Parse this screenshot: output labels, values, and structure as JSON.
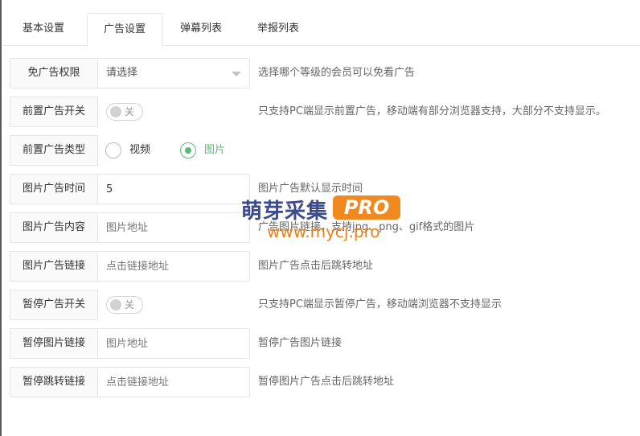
{
  "tabs": [
    {
      "label": "基本设置"
    },
    {
      "label": "广告设置"
    },
    {
      "label": "弹幕列表"
    },
    {
      "label": "举报列表"
    }
  ],
  "active_tab": "广告设置",
  "form": {
    "ad_free": {
      "label": "免广告权限",
      "selected": "请选择",
      "hint": "选择哪个等级的会员可以免看广告"
    },
    "pre_switch": {
      "label": "前置广告开关",
      "state": "关",
      "hint": "只支持PC端显示前置广告，移动端有部分浏览器支持，大部分不支持显示。"
    },
    "pre_type": {
      "label": "前置广告类型",
      "options": [
        "视频",
        "图片"
      ],
      "selected": "图片"
    },
    "img_time": {
      "label": "图片广告时间",
      "value": "5",
      "hint": "图片广告默认显示时间"
    },
    "img_content": {
      "label": "图片广告内容",
      "placeholder": "图片地址",
      "hint": "广告图片链接，支持jpg、png、gif格式的图片"
    },
    "img_link": {
      "label": "图片广告链接",
      "placeholder": "点击链接地址",
      "hint": "图片广告点击后跳转地址"
    },
    "pause_switch": {
      "label": "暂停广告开关",
      "state": "关",
      "hint": "只支持PC端显示暂停广告，移动端浏览器不支持显示"
    },
    "pause_img": {
      "label": "暂停图片链接",
      "placeholder": "图片地址",
      "hint": "暂停广告图片链接"
    },
    "pause_jump": {
      "label": "暂停跳转链接",
      "placeholder": "点击链接地址",
      "hint": "暂停图片广告点击后跳转地址"
    }
  },
  "watermark": {
    "cn": "萌芽采集",
    "pro": "PRO",
    "url": "www.mycj.pro"
  },
  "colors": {
    "accent": "#5fb878",
    "watermark_orange": "#f08a1e",
    "watermark_blue": "#3a4a8a"
  }
}
